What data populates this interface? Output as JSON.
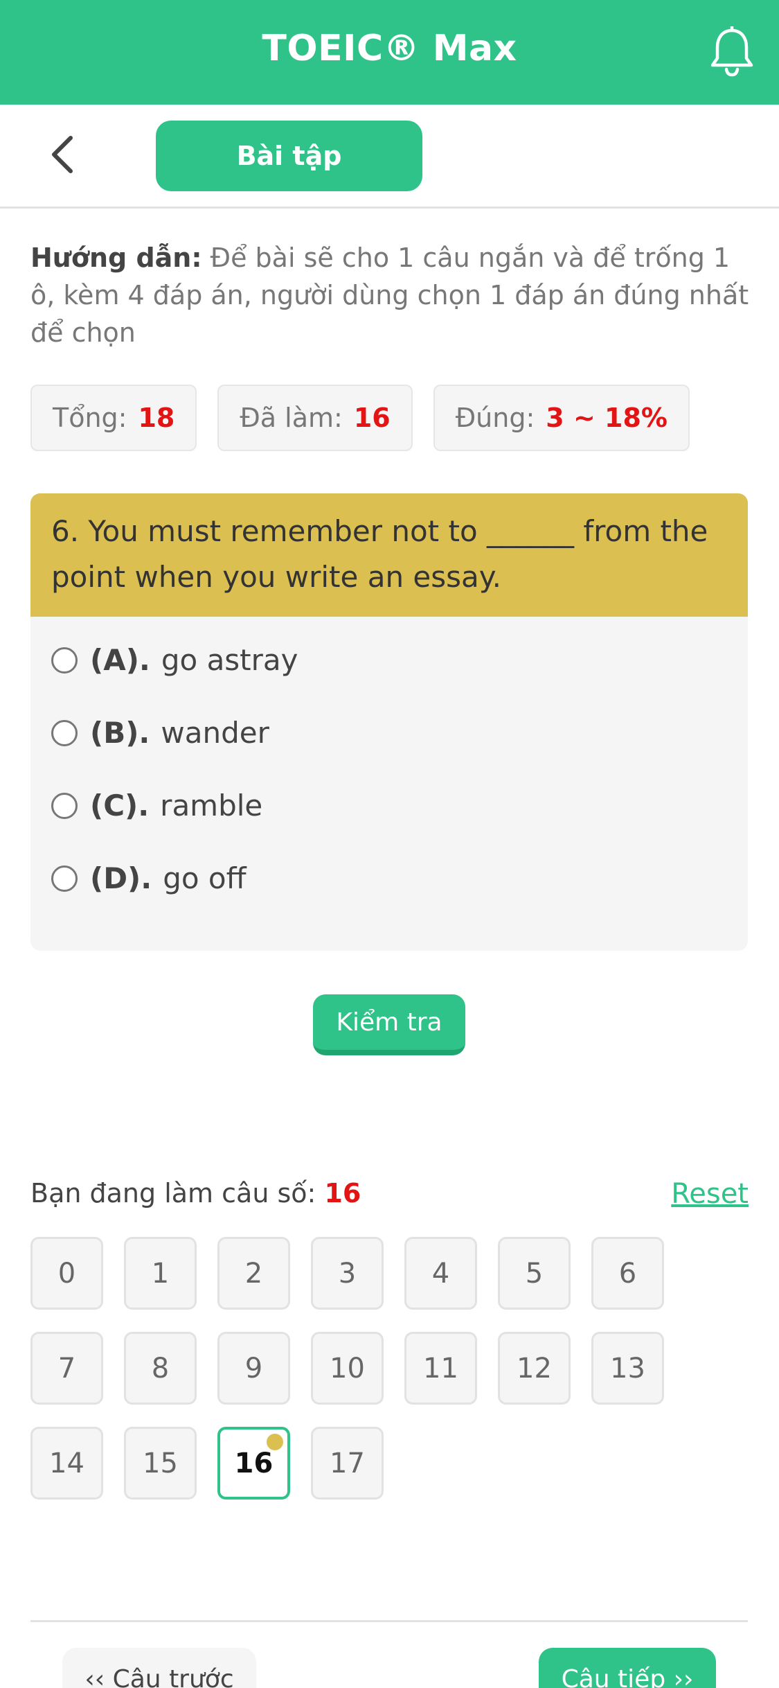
{
  "header": {
    "title": "TOEIC® Max",
    "bell_icon": "bell-icon"
  },
  "subbar": {
    "back_icon": "chevron-left-icon",
    "tab_label": "Bài tập"
  },
  "guide": {
    "label": "Hướng dẫn:",
    "text": "Để bài sẽ cho 1 câu ngắn và để trống 1 ô, kèm 4 đáp án, người dùng chọn 1 đáp án đúng nhất để chọn"
  },
  "stats": {
    "total_label": "Tổng:",
    "total_value": "18",
    "done_label": "Đã làm:",
    "done_value": "16",
    "correct_label": "Đúng:",
    "correct_value": "3 ~ 18%"
  },
  "question": {
    "text": "6. You must remember not to ______ from the point when you write an essay.",
    "options": [
      {
        "letter": "(A).",
        "text": "go astray"
      },
      {
        "letter": "(B).",
        "text": "wander"
      },
      {
        "letter": "(C).",
        "text": "ramble"
      },
      {
        "letter": "(D).",
        "text": "go off"
      }
    ]
  },
  "check_label": "Kiểm tra",
  "progress": {
    "label": "Bạn đang làm câu số:",
    "value": "16",
    "reset_label": "Reset"
  },
  "numbers": [
    "0",
    "1",
    "2",
    "3",
    "4",
    "5",
    "6",
    "7",
    "8",
    "9",
    "10",
    "11",
    "12",
    "13",
    "14",
    "15",
    "16",
    "17"
  ],
  "active_number": "16",
  "nav": {
    "prev_label": "‹‹ Câu trước",
    "next_label": "Câu tiếp ››"
  },
  "colors": {
    "primary": "#2fc389",
    "question_bg": "#dbbf50",
    "highlight": "#e31414"
  }
}
